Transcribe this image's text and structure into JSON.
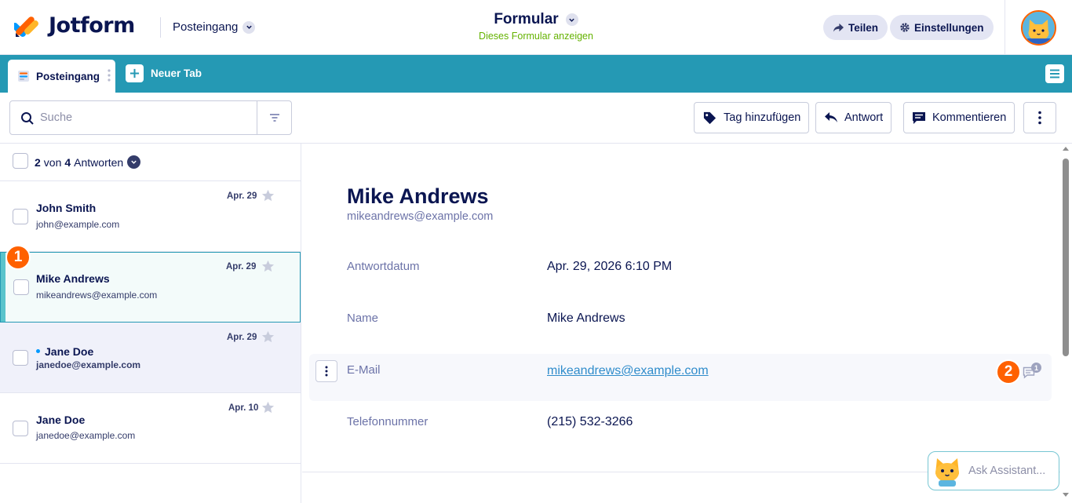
{
  "header": {
    "brand": "Jotform",
    "inbox_label": "Posteingang",
    "form_title": "Formular",
    "form_subtitle": "Dieses Formular anzeigen",
    "share_label": "Teilen",
    "settings_label": "Einstellungen"
  },
  "tabs": {
    "active_tab": "Posteingang",
    "new_tab": "Neuer Tab"
  },
  "toolbar": {
    "search_placeholder": "Suche",
    "tag_label": "Tag hinzufügen",
    "reply_label": "Antwort",
    "comment_label": "Kommentieren"
  },
  "list": {
    "count_selected": "2",
    "count_of": "von",
    "count_total": "4",
    "count_suffix": "Antworten",
    "items": [
      {
        "name": "John Smith",
        "email": "john@example.com",
        "date": "Apr. 29",
        "state": "read"
      },
      {
        "name": "Mike Andrews",
        "email": "mikeandrews@example.com",
        "date": "Apr. 29",
        "state": "selected"
      },
      {
        "name": "Jane Doe",
        "email": "janedoe@example.com",
        "date": "Apr. 29",
        "state": "unread"
      },
      {
        "name": "Jane Doe",
        "email": "janedoe@example.com",
        "date": "Apr. 10",
        "state": "read"
      }
    ]
  },
  "badges": {
    "first": "1",
    "second": "2"
  },
  "detail": {
    "name": "Mike Andrews",
    "email": "mikeandrews@example.com",
    "fields": [
      {
        "label": "Antwortdatum",
        "value": "Apr. 29, 2026 6:10 PM"
      },
      {
        "label": "Name",
        "value": "Mike Andrews"
      },
      {
        "label": "E-Mail",
        "value": "mikeandrews@example.com"
      },
      {
        "label": "Telefonnummer",
        "value": "(215) 532-3266"
      }
    ],
    "comment_count": "1"
  },
  "assistant": {
    "placeholder": "Ask Assistant..."
  },
  "colors": {
    "accent": "#2599b4",
    "brand_navy": "#0a1551",
    "badge_orange": "#ff6100",
    "subtitle_green": "#64b200",
    "link_blue": "#2f8ccb"
  }
}
